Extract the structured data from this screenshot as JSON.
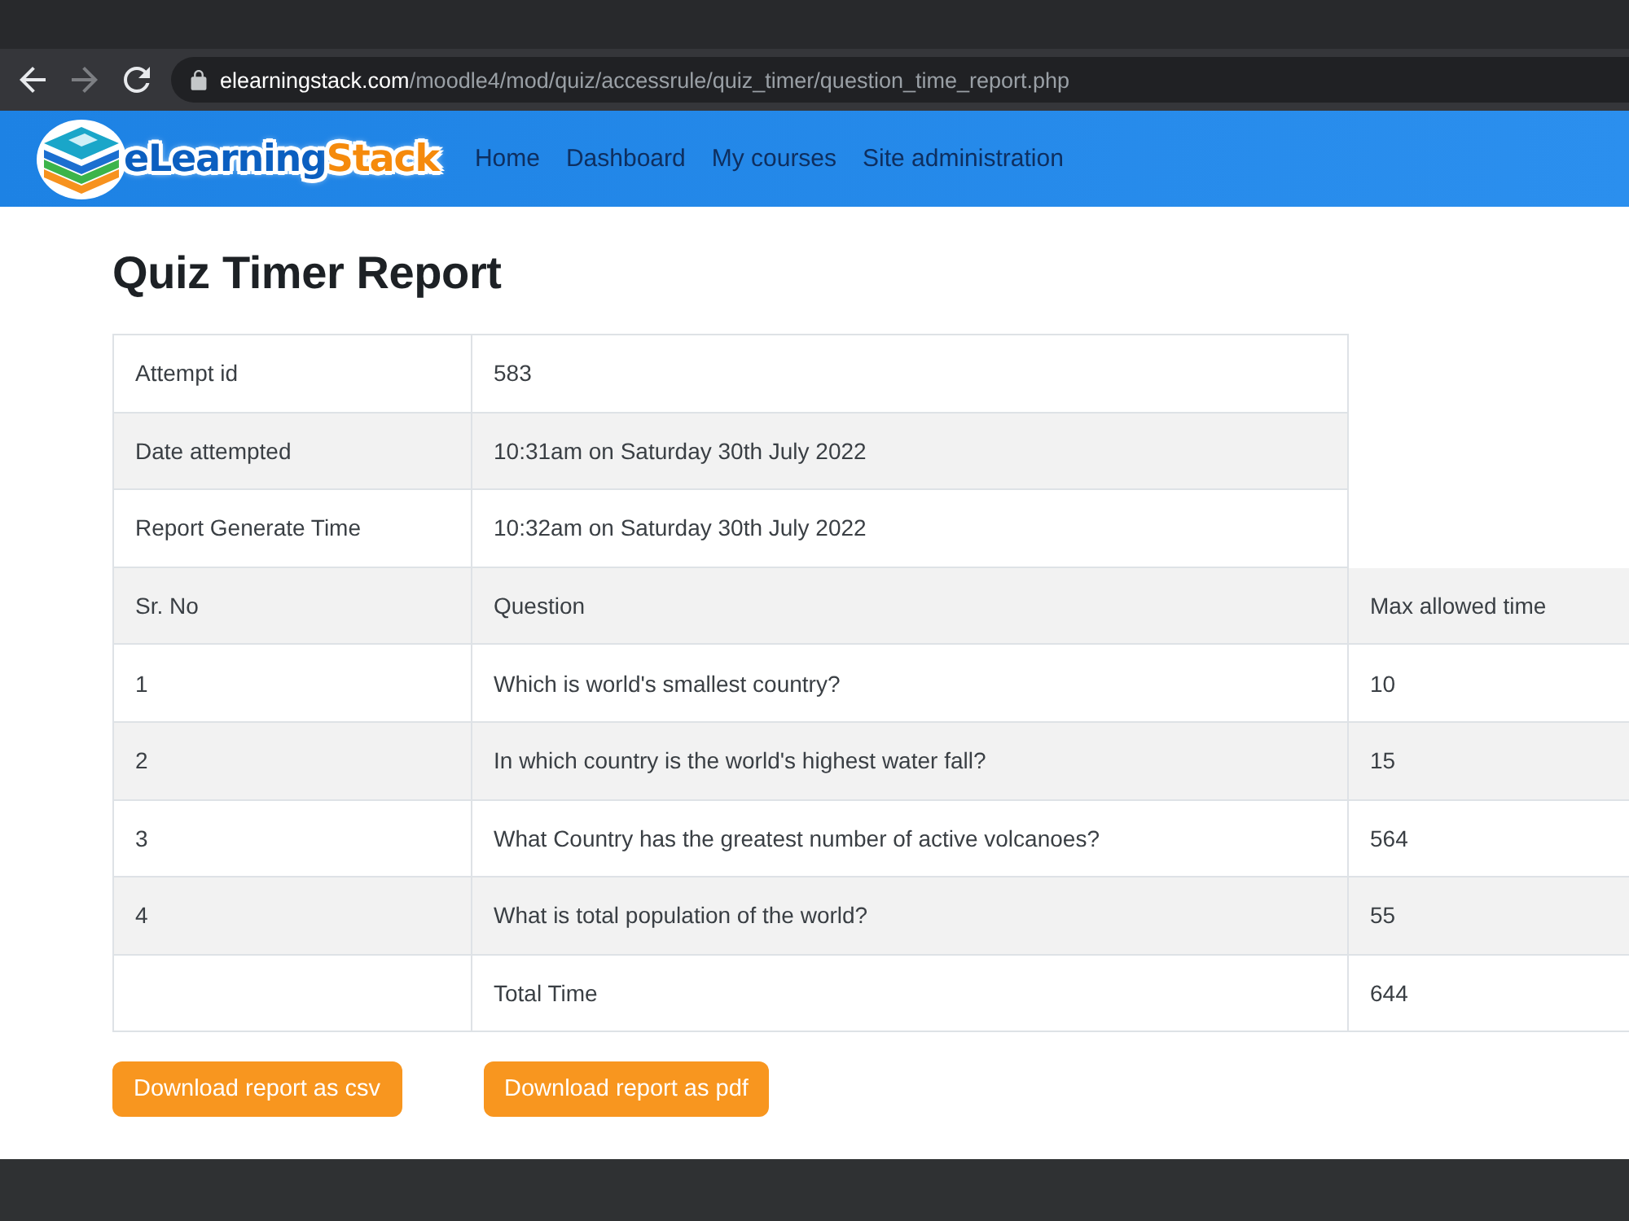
{
  "browser": {
    "nav_buttons": [
      {
        "kind": "back",
        "disabled": false
      },
      {
        "kind": "forward",
        "disabled": true
      },
      {
        "kind": "reload",
        "disabled": false
      }
    ],
    "url": {
      "host": "elearningstack.com",
      "path": "/moodle4/mod/quiz/accessrule/quiz_timer/question_time_report.php"
    }
  },
  "navbar": {
    "logo": {
      "parts": [
        "eLearning",
        "Stack"
      ]
    },
    "links": [
      "Home",
      "Dashboard",
      "My courses",
      "Site administration"
    ]
  },
  "page": {
    "title": "Quiz Timer Report"
  },
  "report_table": {
    "info_rows": [
      {
        "label": "Attempt id",
        "value": "583"
      },
      {
        "label": "Date attempted",
        "value": "10:31am on Saturday 30th July 2022"
      },
      {
        "label": "Report Generate Time",
        "value": "10:32am on Saturday 30th July 2022"
      }
    ],
    "columns": [
      "Sr. No",
      "Question",
      "Max allowed time"
    ],
    "rows": [
      {
        "sr_no": "1",
        "question": "Which is world's smallest country?",
        "max_allowed_time": "10"
      },
      {
        "sr_no": "2",
        "question": "In which country is the world's highest water fall?",
        "max_allowed_time": "15"
      },
      {
        "sr_no": "3",
        "question": "What Country has the greatest number of active volcanoes?",
        "max_allowed_time": "564"
      },
      {
        "sr_no": "4",
        "question": "What is total population of the world?",
        "max_allowed_time": "55"
      },
      {
        "question": "Total Time",
        "max_allowed_time": "644"
      }
    ]
  },
  "buttons": [
    "Download report as csv",
    "Download report as pdf"
  ]
}
